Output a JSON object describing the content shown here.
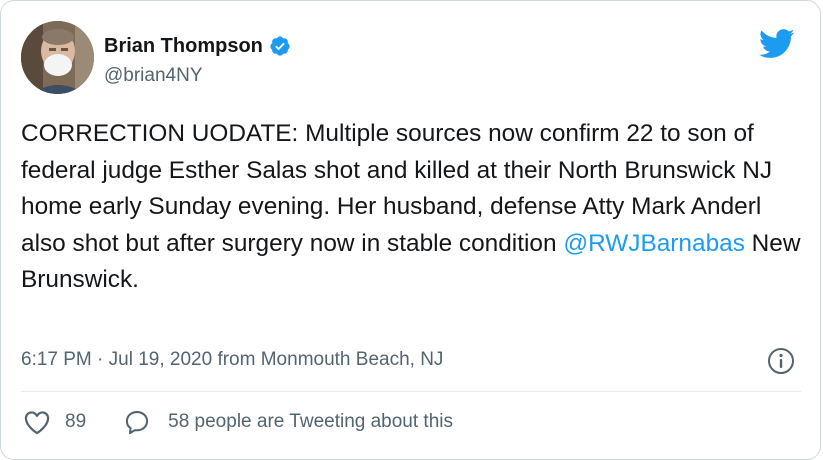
{
  "author": {
    "name": "Brian Thompson",
    "handle": "@brian4NY",
    "verified": true
  },
  "tweet": {
    "text_before": "CORRECTION UODATE: Multiple sources now confirm 22 to son of federal judge Esther Salas shot and killed at their North Brunswick NJ home early Sunday evening. Her husband, defense Atty Mark Anderl also shot but after surgery now in stable condition ",
    "mention": "@RWJBarnabas",
    "text_after": " New Brunswick.",
    "timestamp": "6:17 PM · Jul 19, 2020 from Monmouth Beach, NJ"
  },
  "actions": {
    "like_count": "89",
    "discussion": "58 people are Tweeting about this"
  },
  "icons": {
    "verified": "verified-badge-icon",
    "logo": "twitter-bird-icon",
    "info": "info-icon",
    "like": "heart-icon",
    "reply": "speech-bubble-icon"
  },
  "colors": {
    "accent": "#1d9bf0",
    "text": "#14171a",
    "secondary": "#536471"
  }
}
